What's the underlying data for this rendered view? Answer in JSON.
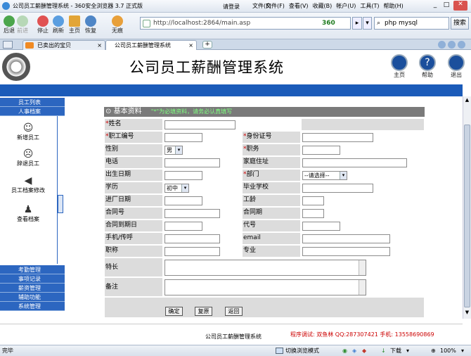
{
  "browser": {
    "title": "公司员工薪酬管理系统 - 360安全浏览器 3.7 正式版",
    "login": "请登录",
    "menu": [
      "文件(F)",
      "查看(V)",
      "收藏(B)",
      "帐户(U)",
      "工具(T)",
      "帮助(H)"
    ],
    "nav": [
      "后退",
      "前进",
      "停止",
      "刷新",
      "主页",
      "恢复",
      "无痕"
    ],
    "address": "http://localhost:2864/main.asp",
    "brand": "360",
    "search_value": "php mysql",
    "search_button": "搜索",
    "tabs": [
      "已卖出的宝贝",
      "公司员工薪酬管理系统"
    ],
    "status_left": "完毕",
    "status_mode": "切换浏览模式",
    "status_download": "下载",
    "status_zoom": "100%"
  },
  "page": {
    "title": "公司员工薪酬管理系统",
    "header_buttons": [
      "主页",
      "帮助",
      "退出"
    ],
    "sidebar_top": [
      "员工列表",
      "人事档案"
    ],
    "sidebar_items": [
      "新增员工",
      "辞退员工",
      "员工档案修改",
      "查看档案"
    ],
    "sidebar_bottom": [
      "考勤管理",
      "事项记录",
      "薪资管理",
      "辅助功能",
      "系统管理"
    ],
    "form_title": "基本资料",
    "form_note": "\"*\"为必填资料，请务必认真填写",
    "labels": {
      "name": "姓名",
      "emp_no": "职工编号",
      "id_no": "身份证号",
      "gender": "性别",
      "position": "职务",
      "phone": "电话",
      "address": "家庭住址",
      "birth": "出生日期",
      "dept": "部门",
      "edu": "学历",
      "school": "毕业学校",
      "join": "进厂日期",
      "years": "工龄",
      "contract_no": "合同号",
      "contract_term": "合同期",
      "contract_end": "合同到期日",
      "code": "代号",
      "mobile": "手机/传呼",
      "email": "email",
      "title": "职称",
      "major": "专业",
      "skill": "特长",
      "remark": "备注"
    },
    "selects": {
      "gender": "男",
      "dept": "--请选择--",
      "edu": "初中"
    },
    "buttons": [
      "确定",
      "复原",
      "返回"
    ],
    "footer_name": "公司员工薪酬管理系统",
    "footer_credit": "程序调试: 双鱼林  QQ:287307421  手机: 13558690869",
    "colors": {
      "accent": "#1b5bb9",
      "sidebar": "#2c66c0",
      "required": "#cc0000",
      "credit": "#cc0000"
    }
  }
}
